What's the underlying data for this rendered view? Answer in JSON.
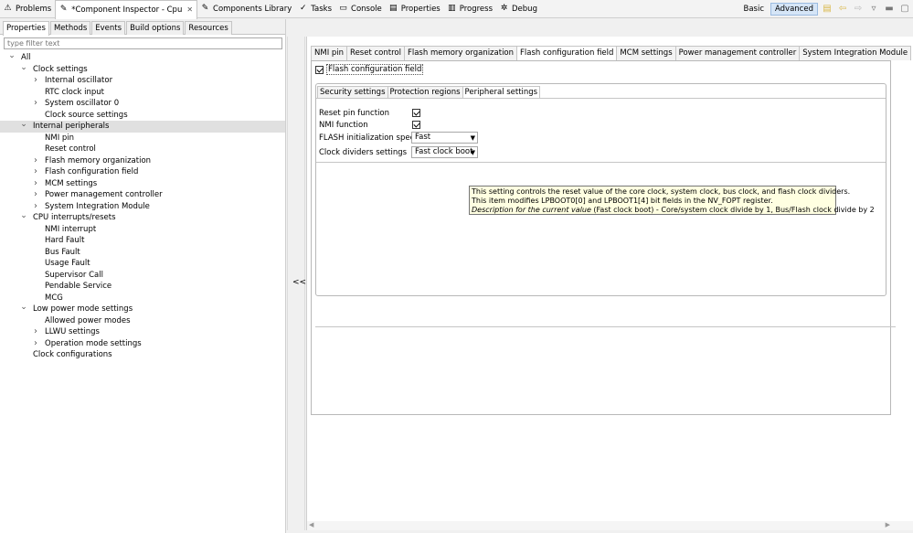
{
  "view_tabs": [
    {
      "label": "Problems",
      "icon": "problems-icon",
      "glyph": "⚠"
    },
    {
      "label": "*Component Inspector - Cpu",
      "icon": "component-inspector-icon",
      "glyph": "✎",
      "active": true
    },
    {
      "label": "Components Library",
      "icon": "components-library-icon",
      "glyph": "✎"
    },
    {
      "label": "Tasks",
      "icon": "tasks-icon",
      "glyph": "✓"
    },
    {
      "label": "Console",
      "icon": "console-icon",
      "glyph": "▭"
    },
    {
      "label": "Properties",
      "icon": "properties-icon",
      "glyph": "▤"
    },
    {
      "label": "Progress",
      "icon": "progress-icon",
      "glyph": "▥"
    },
    {
      "label": "Debug",
      "icon": "debug-icon",
      "glyph": "✲"
    }
  ],
  "mode": {
    "basic": "Basic",
    "advanced": "Advanced"
  },
  "left_tabs": [
    "Properties",
    "Methods",
    "Events",
    "Build options",
    "Resources"
  ],
  "filter_placeholder": "type filter text",
  "tree": [
    {
      "label": "All",
      "level": 0,
      "tw": "v"
    },
    {
      "label": "Clock settings",
      "level": 1,
      "tw": "v"
    },
    {
      "label": "Internal oscillator",
      "level": 2,
      "tw": ">"
    },
    {
      "label": "RTC clock input",
      "level": 2,
      "tw": ""
    },
    {
      "label": "System oscillator 0",
      "level": 2,
      "tw": ">"
    },
    {
      "label": "Clock source settings",
      "level": 2,
      "tw": ""
    },
    {
      "label": "Internal peripherals",
      "level": 1,
      "tw": "v",
      "selected": true
    },
    {
      "label": "NMI pin",
      "level": 2,
      "tw": ""
    },
    {
      "label": "Reset control",
      "level": 2,
      "tw": ""
    },
    {
      "label": "Flash memory organization",
      "level": 2,
      "tw": ">"
    },
    {
      "label": "Flash configuration field",
      "level": 2,
      "tw": ">"
    },
    {
      "label": "MCM settings",
      "level": 2,
      "tw": ">"
    },
    {
      "label": "Power management controller",
      "level": 2,
      "tw": ">"
    },
    {
      "label": "System Integration Module",
      "level": 2,
      "tw": ">"
    },
    {
      "label": "CPU interrupts/resets",
      "level": 1,
      "tw": "v"
    },
    {
      "label": "NMI interrupt",
      "level": 2,
      "tw": ""
    },
    {
      "label": "Hard Fault",
      "level": 2,
      "tw": ""
    },
    {
      "label": "Bus Fault",
      "level": 2,
      "tw": ""
    },
    {
      "label": "Usage Fault",
      "level": 2,
      "tw": ""
    },
    {
      "label": "Supervisor Call",
      "level": 2,
      "tw": ""
    },
    {
      "label": "Pendable Service",
      "level": 2,
      "tw": ""
    },
    {
      "label": "MCG",
      "level": 2,
      "tw": ""
    },
    {
      "label": "Low power mode settings",
      "level": 1,
      "tw": "v"
    },
    {
      "label": "Allowed power modes",
      "level": 2,
      "tw": ""
    },
    {
      "label": "LLWU settings",
      "level": 2,
      "tw": ">"
    },
    {
      "label": "Operation mode settings",
      "level": 2,
      "tw": ">"
    },
    {
      "label": "Clock configurations",
      "level": 1,
      "tw": ""
    }
  ],
  "collapse_label": "<<",
  "right_tabs": [
    "NMI pin",
    "Reset control",
    "Flash memory organization",
    "Flash configuration field",
    "MCM settings",
    "Power management controller",
    "System Integration Module"
  ],
  "active_right_tab": "Flash configuration field",
  "group_checkbox_label": "Flash configuration field",
  "sub_tabs": [
    "Security settings",
    "Protection regions",
    "Peripheral settings"
  ],
  "fields": {
    "reset_pin_function": {
      "label": "Reset pin function",
      "checked": true
    },
    "nmi_function": {
      "label": "NMI function",
      "checked": true
    },
    "flash_init_speed": {
      "label": "FLASH initialization speed",
      "value": "Fast"
    },
    "clock_dividers": {
      "label": "Clock dividers settings",
      "value": "Fast clock boot"
    }
  },
  "tooltip": {
    "line1": "This setting controls the reset value of the core clock, system clock, bus clock, and flash clock dividers.",
    "line2": "This item modifies LPBOOT0[0] and LPBOOT1[4] bit fields in the NV_FOPT register.",
    "line3_italic": "Description for the current value",
    "line3_rest": " (Fast clock boot) - Core/system clock divide by 1, Bus/Flash clock divide by 2"
  }
}
